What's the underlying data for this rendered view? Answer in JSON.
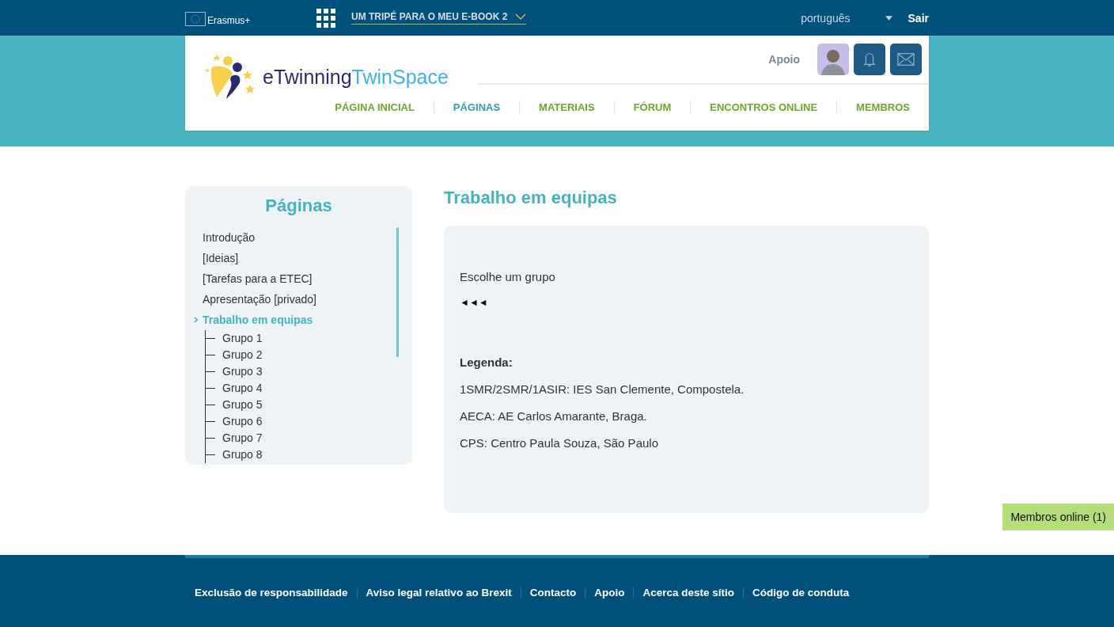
{
  "top_bar": {
    "program": "Erasmus+",
    "project": "UM TRIPÉ PARA O MEU E-BOOK 2",
    "language": "português",
    "logout": "Sair"
  },
  "header": {
    "logo_part_1": "eTwinning",
    "logo_part_2": "TwinSpace",
    "support": "Apoio",
    "nav": [
      {
        "label": "PÁGINA INICIAL",
        "selected": false
      },
      {
        "label": "PÁGINAS",
        "selected": true
      },
      {
        "label": "MATERIAIS",
        "selected": false
      },
      {
        "label": "FÓRUM",
        "selected": false
      },
      {
        "label": "ENCONTROS ONLINE",
        "selected": false
      },
      {
        "label": "MEMBROS",
        "selected": false
      }
    ]
  },
  "sidebar": {
    "title": "Páginas",
    "items": [
      {
        "label": "Introdução",
        "selected": false
      },
      {
        "label": "[Ideias]",
        "selected": false
      },
      {
        "label": "[Tarefas para a ETEC]",
        "selected": false
      },
      {
        "label": "Apresentação [privado]",
        "selected": false
      },
      {
        "label": "Trabalho em equipas",
        "selected": true,
        "children": [
          {
            "label": "Grupo 1",
            "selected": false
          },
          {
            "label": "Grupo 2",
            "selected": false
          },
          {
            "label": "Grupo 3",
            "selected": false
          },
          {
            "label": "Grupo 4",
            "selected": false
          },
          {
            "label": "Grupo 5",
            "selected": false
          },
          {
            "label": "Grupo 6",
            "selected": false
          },
          {
            "label": "Grupo 7",
            "selected": false
          },
          {
            "label": "Grupo 8",
            "selected": false
          }
        ]
      }
    ]
  },
  "content": {
    "title": "Trabalho em equipas",
    "prompt": "Escolhe um grupo",
    "arrows": "◄◄◄",
    "legend_title": "Legenda:",
    "legend": [
      "1SMR/2SMR/1ASIR: IES San Clemente, Compostela.",
      "AECA: AE Carlos Amarante, Braga.",
      "CPS: Centro Paula Souza, São Paulo"
    ]
  },
  "online_members": "Membros online (1)",
  "footer": {
    "links": [
      "Exclusão de responsabilidade",
      "Aviso legal relativo ao Brexit",
      "Contacto",
      "Apoio",
      "Acerca deste sítio",
      "Código de conduta"
    ]
  }
}
